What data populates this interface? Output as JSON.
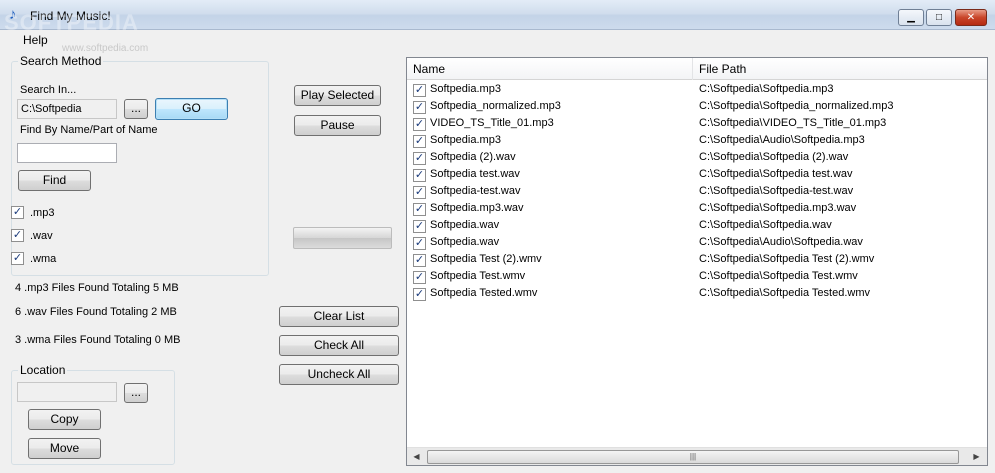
{
  "window": {
    "title": "Find My Music!",
    "watermark": "SOFTPEDIA",
    "watermark_url": "www.softpedia.com",
    "min_glyph": "▁",
    "max_glyph": "□",
    "close_glyph": "✕"
  },
  "menu": {
    "help": "Help"
  },
  "search_method": {
    "group_label": "Search Method",
    "search_in_label": "Search In...",
    "search_in_value": "C:\\Softpedia",
    "browse_label": "...",
    "go_label": "GO",
    "find_by_name_label": "Find By Name/Part of Name",
    "name_value": "",
    "find_label": "Find",
    "extensions": [
      {
        "label": ".mp3",
        "checked": true
      },
      {
        "label": ".wav",
        "checked": true
      },
      {
        "label": ".wma",
        "checked": true
      }
    ]
  },
  "summary": {
    "mp3": "4 .mp3 Files Found Totaling 5 MB",
    "wav": "6 .wav Files Found Totaling 2 MB",
    "wma": "3 .wma Files Found Totaling 0 MB"
  },
  "location": {
    "group_label": "Location",
    "value": "",
    "browse_label": "...",
    "copy_label": "Copy",
    "move_label": "Move"
  },
  "controls": {
    "play_selected": "Play Selected",
    "pause": "Pause",
    "progress": 0,
    "clear_list": "Clear List",
    "check_all": "Check All",
    "uncheck_all": "Uncheck All"
  },
  "list": {
    "columns": [
      "Name",
      "File Path"
    ],
    "rows": [
      {
        "name": "Softpedia.mp3",
        "path": "C:\\Softpedia\\Softpedia.mp3",
        "checked": true
      },
      {
        "name": "Softpedia_normalized.mp3",
        "path": "C:\\Softpedia\\Softpedia_normalized.mp3",
        "checked": true
      },
      {
        "name": "VIDEO_TS_Title_01.mp3",
        "path": "C:\\Softpedia\\VIDEO_TS_Title_01.mp3",
        "checked": true
      },
      {
        "name": "Softpedia.mp3",
        "path": "C:\\Softpedia\\Audio\\Softpedia.mp3",
        "checked": true
      },
      {
        "name": "Softpedia (2).wav",
        "path": "C:\\Softpedia\\Softpedia (2).wav",
        "checked": true
      },
      {
        "name": "Softpedia test.wav",
        "path": "C:\\Softpedia\\Softpedia test.wav",
        "checked": true
      },
      {
        "name": "Softpedia-test.wav",
        "path": "C:\\Softpedia\\Softpedia-test.wav",
        "checked": true
      },
      {
        "name": "Softpedia.mp3.wav",
        "path": "C:\\Softpedia\\Softpedia.mp3.wav",
        "checked": true
      },
      {
        "name": "Softpedia.wav",
        "path": "C:\\Softpedia\\Softpedia.wav",
        "checked": true
      },
      {
        "name": "Softpedia.wav",
        "path": "C:\\Softpedia\\Audio\\Softpedia.wav",
        "checked": true
      },
      {
        "name": "Softpedia Test (2).wmv",
        "path": "C:\\Softpedia\\Softpedia Test (2).wmv",
        "checked": true
      },
      {
        "name": "Softpedia Test.wmv",
        "path": "C:\\Softpedia\\Softpedia Test.wmv",
        "checked": true
      },
      {
        "name": "Softpedia Tested.wmv",
        "path": "C:\\Softpedia\\Softpedia Tested.wmv",
        "checked": true
      }
    ],
    "scroll_left_glyph": "◀",
    "scroll_right_glyph": "▶",
    "scroll_thumb_grip": "|||"
  }
}
